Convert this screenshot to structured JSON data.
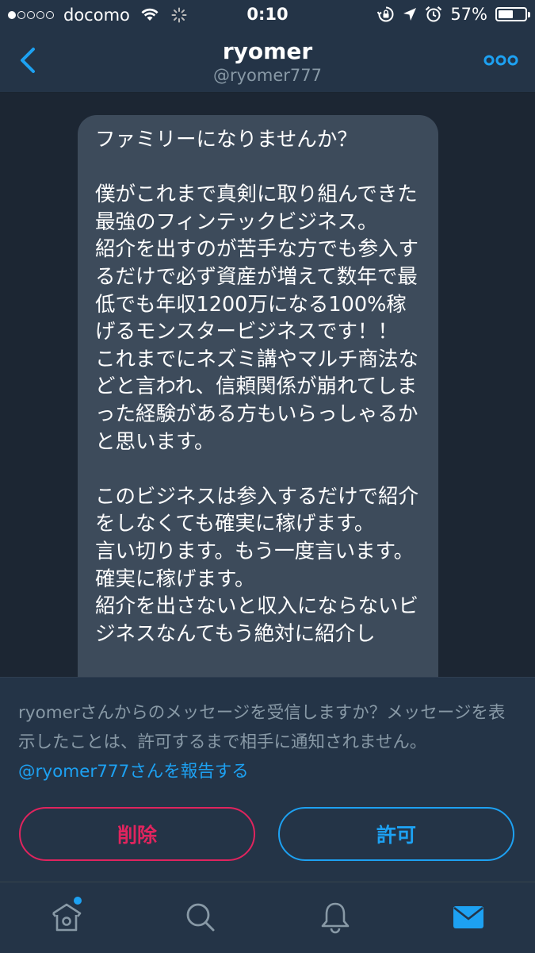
{
  "status_bar": {
    "carrier": "docomo",
    "time": "0:10",
    "battery_percent": "57%",
    "battery_level": 0.57,
    "signal_bars": 1
  },
  "header": {
    "display_name": "ryomer",
    "username": "@ryomer777"
  },
  "message": {
    "text": "ファミリーになりませんか？\n\n僕がこれまで真剣に取り組んできた最強のフィンテックビジネス。\n紹介を出すのが苦手な方でも参入するだけで必ず資産が増えて数年で最低でも年収1200万になる100%稼げるモンスタービジネスです！！\nこれまでにネズミ講やマルチ商法などと言われ、信頼関係が崩れてしまった経験がある方もいらっしゃるかと思います。\n\nこのビジネスは参入するだけで紹介をしなくても確実に稼げます。\n言い切ります。もう一度言います。確実に稼げます。\n紹介を出さないと収入にならないビジネスなんてもう絶対に紹介し"
  },
  "request": {
    "prompt": "ryomerさんからのメッセージを受信しますか？メッセージを表示したことは、許可するまで相手に通知されません。",
    "report_link": "@ryomer777さんを報告する",
    "delete_label": "削除",
    "allow_label": "許可"
  },
  "tabs": {
    "home_icon": "home-icon",
    "search_icon": "search-icon",
    "notifications_icon": "bell-icon",
    "messages_icon": "mail-icon",
    "active": "messages",
    "home_has_badge": true
  },
  "colors": {
    "accent": "#1da1f2",
    "danger": "#e0245e",
    "background": "#1c2633",
    "panel": "#243447",
    "bubble": "#3d4b5b",
    "secondary_text": "#8899a6"
  }
}
